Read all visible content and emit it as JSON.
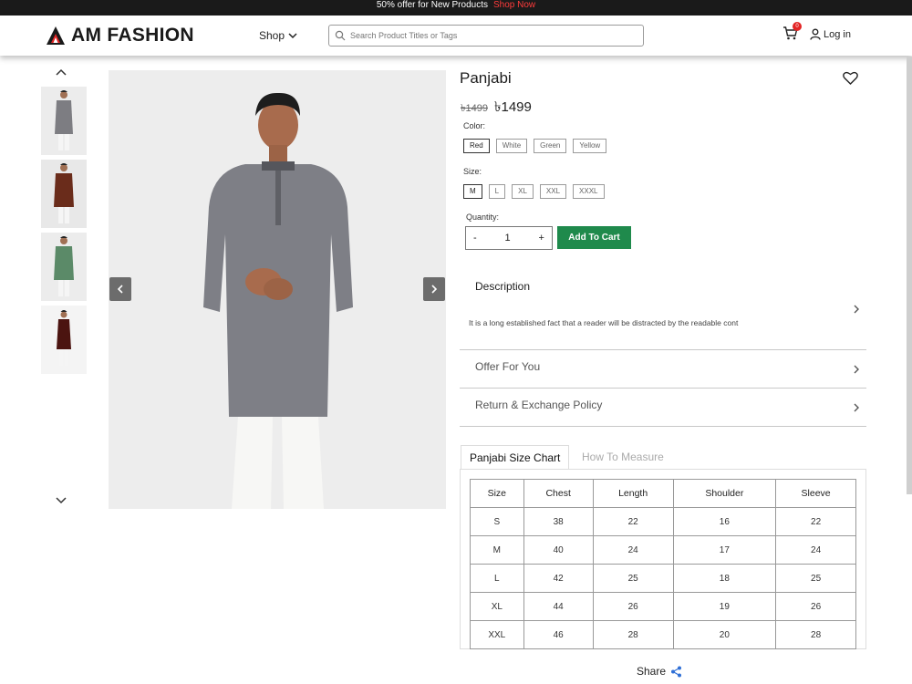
{
  "promo": {
    "text": "50% offer for New Products",
    "link": "Shop Now"
  },
  "header": {
    "logo": "AM FASHION",
    "shop": "Shop",
    "search_placeholder": "Search Product Titles or Tags",
    "cart_count": "0",
    "login": "Log in"
  },
  "product": {
    "title": "Panjabi",
    "old_price": "৳1499",
    "new_price": "৳1499",
    "color_label": "Color:",
    "colors": [
      "Red",
      "White",
      "Green",
      "Yellow"
    ],
    "size_label": "Size:",
    "sizes": [
      "M",
      "L",
      "XL",
      "XXL",
      "XXXL"
    ],
    "quantity_label": "Quantity:",
    "qty_minus": "-",
    "quantity": "1",
    "qty_plus": "+",
    "add_to_cart": "Add To Cart"
  },
  "accordion": {
    "description_title": "Description",
    "description_text": "It is a long established fact that a reader will be distracted by the readable cont",
    "offer_title": "Offer For You",
    "policy_title": "Return & Exchange Policy"
  },
  "tabs": {
    "active": "Panjabi Size Chart",
    "inactive": "How To Measure"
  },
  "size_chart": {
    "headers": [
      "Size",
      "Chest",
      "Length",
      "Shoulder",
      "Sleeve"
    ],
    "rows": [
      [
        "S",
        "38",
        "22",
        "16",
        "22"
      ],
      [
        "M",
        "40",
        "24",
        "17",
        "24"
      ],
      [
        "L",
        "42",
        "25",
        "18",
        "25"
      ],
      [
        "XL",
        "44",
        "26",
        "19",
        "26"
      ],
      [
        "XXL",
        "46",
        "28",
        "20",
        "28"
      ]
    ]
  },
  "share": "Share",
  "colors": {
    "accent_green": "#1f8a4c",
    "promo_red": "#ff3b3b",
    "badge_red": "#e32424"
  }
}
